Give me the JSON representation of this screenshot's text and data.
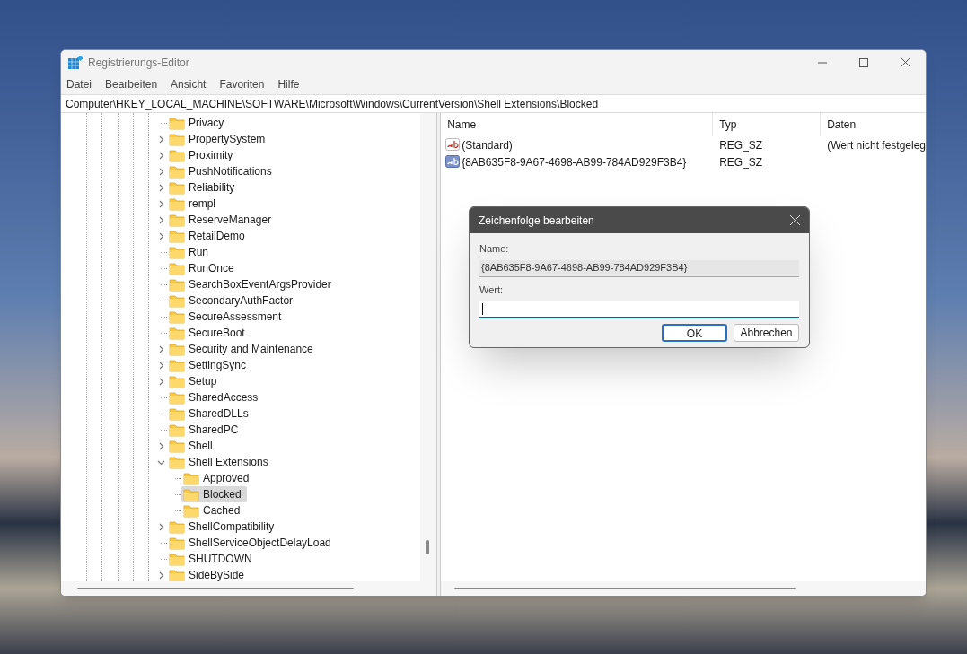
{
  "window": {
    "title": "Registrierungs-Editor"
  },
  "menu": [
    "Datei",
    "Bearbeiten",
    "Ansicht",
    "Favoriten",
    "Hilfe"
  ],
  "address": "Computer\\HKEY_LOCAL_MACHINE\\SOFTWARE\\Microsoft\\Windows\\CurrentVersion\\Shell Extensions\\Blocked",
  "tree": [
    {
      "label": "Privacy",
      "kind": "leaf",
      "selected": false
    },
    {
      "label": "PropertySystem",
      "kind": "branch",
      "expanded": false,
      "selected": false
    },
    {
      "label": "Proximity",
      "kind": "branch",
      "expanded": false,
      "selected": false
    },
    {
      "label": "PushNotifications",
      "kind": "branch",
      "expanded": false,
      "selected": false
    },
    {
      "label": "Reliability",
      "kind": "branch",
      "expanded": false,
      "selected": false
    },
    {
      "label": "rempl",
      "kind": "branch",
      "expanded": false,
      "selected": false
    },
    {
      "label": "ReserveManager",
      "kind": "branch",
      "expanded": false,
      "selected": false
    },
    {
      "label": "RetailDemo",
      "kind": "branch",
      "expanded": false,
      "selected": false
    },
    {
      "label": "Run",
      "kind": "leaf",
      "selected": false
    },
    {
      "label": "RunOnce",
      "kind": "leaf",
      "selected": false
    },
    {
      "label": "SearchBoxEventArgsProvider",
      "kind": "leaf",
      "selected": false
    },
    {
      "label": "SecondaryAuthFactor",
      "kind": "leaf",
      "selected": false
    },
    {
      "label": "SecureAssessment",
      "kind": "leaf",
      "selected": false
    },
    {
      "label": "SecureBoot",
      "kind": "leaf",
      "selected": false
    },
    {
      "label": "Security and Maintenance",
      "kind": "branch",
      "expanded": false,
      "selected": false
    },
    {
      "label": "SettingSync",
      "kind": "branch",
      "expanded": false,
      "selected": false
    },
    {
      "label": "Setup",
      "kind": "branch",
      "expanded": false,
      "selected": false
    },
    {
      "label": "SharedAccess",
      "kind": "leaf",
      "selected": false
    },
    {
      "label": "SharedDLLs",
      "kind": "leaf",
      "selected": false
    },
    {
      "label": "SharedPC",
      "kind": "leaf",
      "selected": false
    },
    {
      "label": "Shell",
      "kind": "branch",
      "expanded": false,
      "selected": false
    },
    {
      "label": "Shell Extensions",
      "kind": "branch",
      "expanded": true,
      "selected": false,
      "children": [
        {
          "label": "Approved",
          "kind": "leaf",
          "selected": false
        },
        {
          "label": "Blocked",
          "kind": "leaf",
          "selected": true
        },
        {
          "label": "Cached",
          "kind": "leaf",
          "selected": false
        }
      ]
    },
    {
      "label": "ShellCompatibility",
      "kind": "branch",
      "expanded": false,
      "selected": false
    },
    {
      "label": "ShellServiceObjectDelayLoad",
      "kind": "leaf",
      "selected": false
    },
    {
      "label": "SHUTDOWN",
      "kind": "leaf",
      "selected": false
    },
    {
      "label": "SideBySide",
      "kind": "branch",
      "expanded": false,
      "selected": false
    }
  ],
  "table": {
    "columns": [
      "Name",
      "Typ",
      "Daten"
    ],
    "rows": [
      {
        "name": "(Standard)",
        "type": "REG_SZ",
        "data": "(Wert nicht festgeleg",
        "selected": false
      },
      {
        "name": "{8AB635F8-9A67-4698-AB99-784AD929F3B4}",
        "type": "REG_SZ",
        "selected": true
      }
    ]
  },
  "dialog": {
    "title": "Zeichenfolge bearbeiten",
    "name_label": "Name:",
    "name_value": "{8AB635F8-9A67-4698-AB99-784AD929F3B4}",
    "value_label": "Wert:",
    "buttons": [
      {
        "label": "OK",
        "default": true
      },
      {
        "label": "Abbrechen",
        "default": false
      }
    ]
  }
}
